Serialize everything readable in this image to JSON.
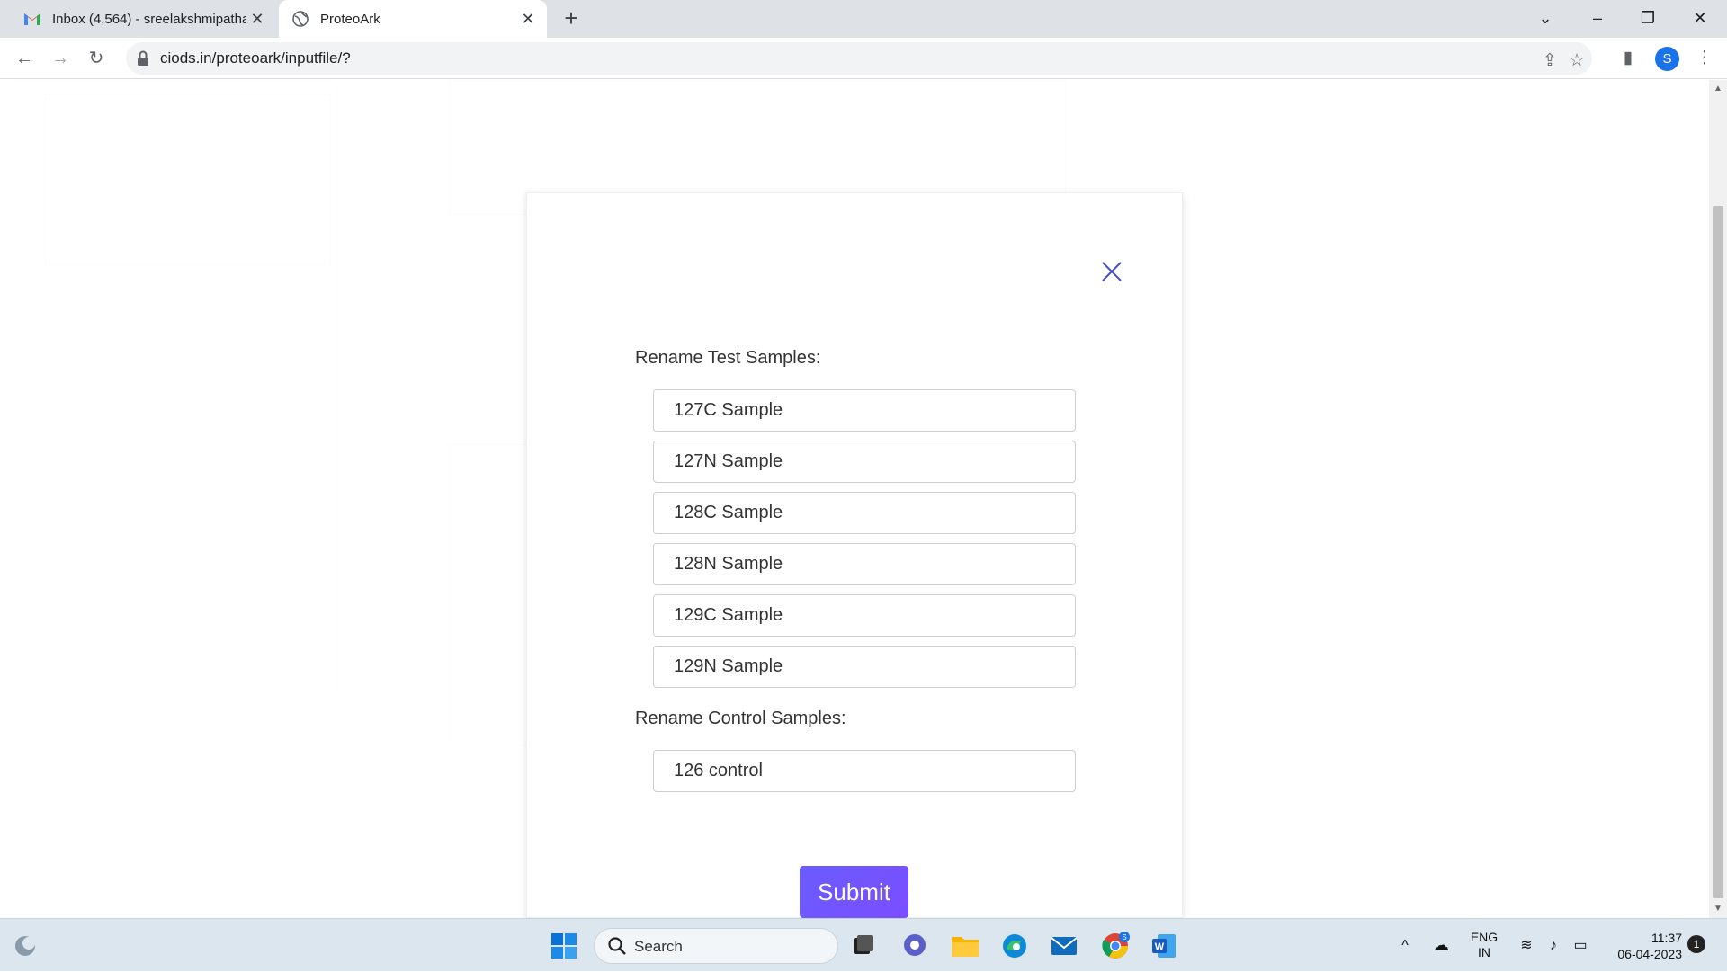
{
  "browser": {
    "tabs": [
      {
        "title": "Inbox (4,564) - sreelakshmipatha",
        "active": false
      },
      {
        "title": "ProteoArk",
        "active": true
      }
    ],
    "url": "ciods.in/proteoark/inputfile/?",
    "profile_initial": "S"
  },
  "modal": {
    "test_label": "Rename Test Samples:",
    "test_samples": [
      "127C Sample",
      "127N Sample",
      "128C Sample",
      "128N Sample",
      "129C Sample",
      "129N Sample"
    ],
    "control_label": "Rename Control Samples:",
    "control_samples": [
      "126 control"
    ]
  },
  "submit_label": "Submit",
  "taskbar": {
    "search_label": "Search",
    "lang_top": "ENG",
    "lang_bottom": "IN",
    "time": "11:37",
    "date": "06-04-2023",
    "notifications": "1",
    "chrome_badge": "S"
  },
  "colors": {
    "accent": "#6a5cff",
    "close_icon": "#4a4fc4"
  }
}
